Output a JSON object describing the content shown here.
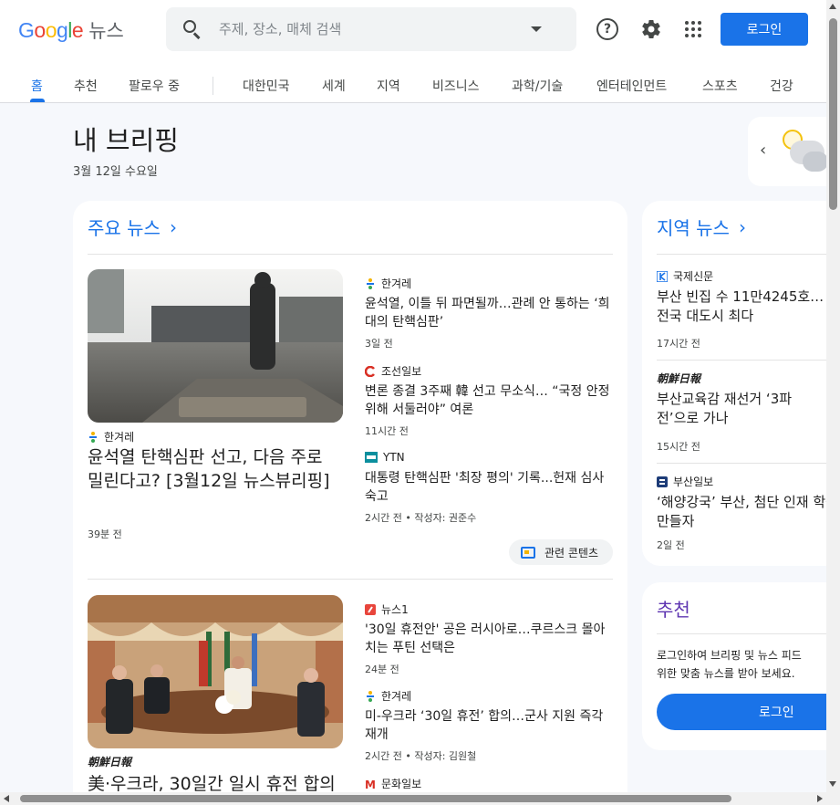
{
  "header": {
    "logo_google": "Google",
    "logo_news": "뉴스",
    "search_placeholder": "주제, 장소, 매체 검색",
    "login_label": "로그인",
    "help_glyph": "?"
  },
  "nav": {
    "tabs": [
      {
        "label": "홈",
        "active": true
      },
      {
        "label": "추천"
      },
      {
        "label": "팔로우 중"
      },
      {
        "label": "대한민국"
      },
      {
        "label": "세계"
      },
      {
        "label": "지역"
      },
      {
        "label": "비즈니스"
      },
      {
        "label": "과학/기술"
      },
      {
        "label": "엔터테인먼트"
      },
      {
        "label": "스포츠"
      },
      {
        "label": "건강"
      }
    ]
  },
  "briefing": {
    "title": "내 브리핑",
    "date": "3월 12일 수요일"
  },
  "top_news": {
    "title": "주요 뉴스",
    "arrow": "›",
    "cluster1": {
      "main": {
        "source": "한겨레",
        "headline": "윤석열 탄핵심판 선고, 다음 주로 밀린다고? [3월12일 뉴스뷰리핑]",
        "time": "39분 전"
      },
      "side": [
        {
          "source": "한겨레",
          "headline": "윤석열, 이틀 뒤 파면될까…관례 안 통하는 ‘희대의 탄핵심판’",
          "time": "3일 전"
        },
        {
          "source": "조선일보",
          "headline": "변론 종결 3주째 韓 선고 무소식… “국정 안정 위해 서둘러야” 여론",
          "time": "11시간 전"
        },
        {
          "source": "YTN",
          "headline": "대통령 탄핵심판 '최장 평의' 기록...헌재 심사숙고",
          "time": "2시간 전 • 작성자: 권준수"
        }
      ],
      "related_label": "관련 콘텐츠"
    },
    "cluster2": {
      "main": {
        "source": "朝鮮日報",
        "headline": "美·우크라, 30일간 일시 휴전 합의"
      },
      "side": [
        {
          "source": "뉴스1",
          "headline": "'30일 휴전안' 공은 러시아로…쿠르스크 몰아치는 푸틴 선택은",
          "time": "24분 전"
        },
        {
          "source": "한겨레",
          "headline": "미-우크라 ‘30일 휴전’ 합의…군사 지원 즉각 재개",
          "time": "2시간 전 • 작성자: 김원철"
        },
        {
          "source": "문화일보"
        }
      ]
    }
  },
  "local_news": {
    "title": "지역 뉴스",
    "arrow": "›",
    "items": [
      {
        "source": "국제신문",
        "headline": "부산 빈집 수 11만4245호… 전국 대도시 최다",
        "time": "17시간 전"
      },
      {
        "source": "朝鮮日報",
        "headline": "부산교육감 재선거 ‘3파전’으로 가나",
        "time": "15시간 전"
      },
      {
        "source": "부산일보",
        "headline": "‘해양강국’ 부산, 첨단 인재 학원 만들자",
        "time": "2일 전"
      }
    ]
  },
  "recommend": {
    "title": "추천",
    "text_line1": "로그인하여 브리핑 및 뉴스 피드",
    "text_line2": "위한 맞춤 뉴스를 받아 보세요.",
    "login_label": "로그인"
  },
  "colors": {
    "accent": "#1a73e8",
    "purple": "#5e35b1",
    "background": "#f6f8fc"
  }
}
